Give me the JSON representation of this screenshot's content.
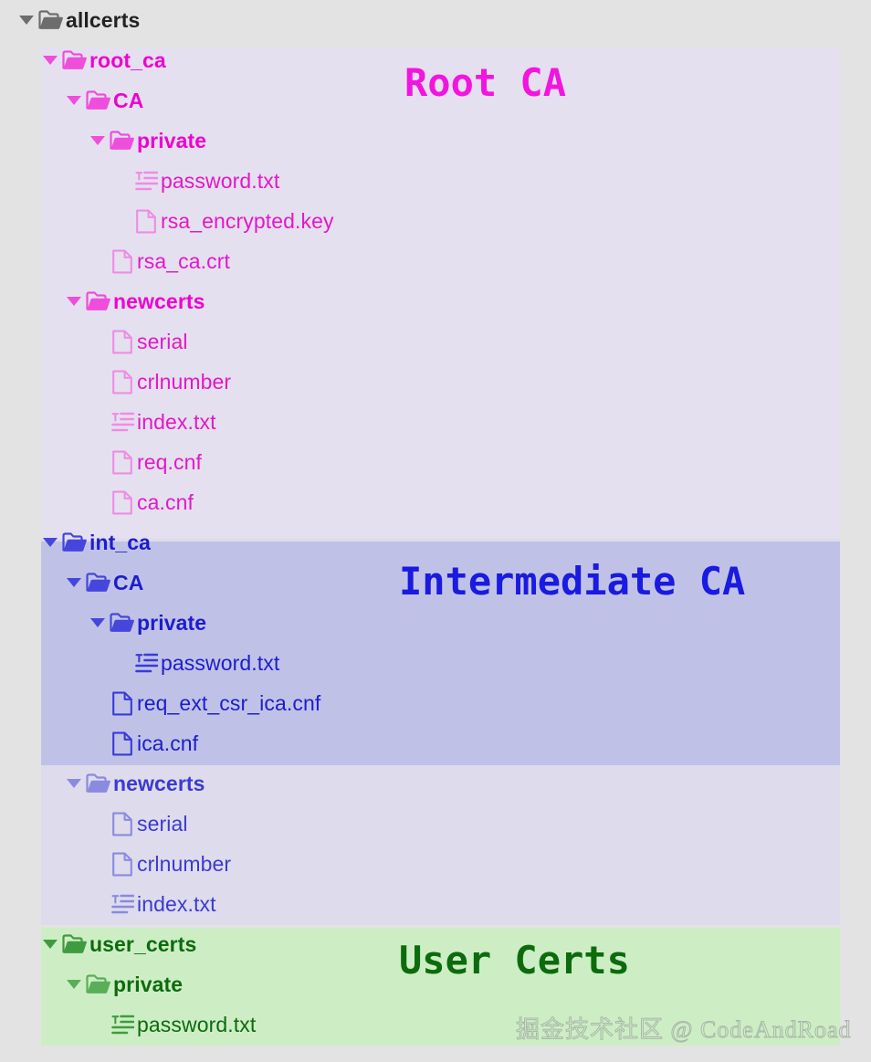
{
  "root_label": "allcerts",
  "groups": [
    {
      "id": "root_ca",
      "annotation": "Root CA",
      "accent": "#f215e0"
    },
    {
      "id": "int_ca",
      "annotation": "Intermediate CA",
      "accent": "#1a1ae0"
    },
    {
      "id": "user_certs",
      "annotation": "User Certs",
      "accent": "#0c6b0c"
    }
  ],
  "tree": [
    {
      "label": "allcerts",
      "kind": "folder",
      "icon": "folder-icon",
      "depth": 0,
      "expanded": true,
      "theme": "c-gray"
    },
    {
      "label": "root_ca",
      "kind": "folder",
      "icon": "folder-icon",
      "depth": 1,
      "expanded": true,
      "theme": "c-pinkd"
    },
    {
      "label": "CA",
      "kind": "folder",
      "icon": "folder-icon",
      "depth": 2,
      "expanded": true,
      "theme": "c-pinkd"
    },
    {
      "label": "private",
      "kind": "folder",
      "icon": "folder-icon",
      "depth": 3,
      "expanded": true,
      "theme": "c-pinkd"
    },
    {
      "label": "password.txt",
      "kind": "file",
      "icon": "text-file-icon",
      "depth": 4,
      "expanded": false,
      "theme": "c-pinkl"
    },
    {
      "label": "rsa_encrypted.key",
      "kind": "file",
      "icon": "file-icon",
      "depth": 4,
      "expanded": false,
      "theme": "c-pinkl"
    },
    {
      "label": "rsa_ca.crt",
      "kind": "file",
      "icon": "file-icon",
      "depth": 3,
      "expanded": false,
      "theme": "c-pinkl"
    },
    {
      "label": "newcerts",
      "kind": "folder",
      "icon": "folder-icon",
      "depth": 2,
      "expanded": true,
      "theme": "c-pinkd"
    },
    {
      "label": "serial",
      "kind": "file",
      "icon": "file-icon",
      "depth": 3,
      "expanded": false,
      "theme": "c-pinkl"
    },
    {
      "label": "crlnumber",
      "kind": "file",
      "icon": "file-icon",
      "depth": 3,
      "expanded": false,
      "theme": "c-pinkl"
    },
    {
      "label": "index.txt",
      "kind": "file",
      "icon": "text-file-icon",
      "depth": 3,
      "expanded": false,
      "theme": "c-pinkl"
    },
    {
      "label": "req.cnf",
      "kind": "file",
      "icon": "file-icon",
      "depth": 3,
      "expanded": false,
      "theme": "c-pinkl"
    },
    {
      "label": "ca.cnf",
      "kind": "file",
      "icon": "file-icon",
      "depth": 3,
      "expanded": false,
      "theme": "c-pinkl"
    },
    {
      "label": "int_ca",
      "kind": "folder",
      "icon": "folder-icon",
      "depth": 1,
      "expanded": true,
      "theme": "c-bluem"
    },
    {
      "label": "CA",
      "kind": "folder",
      "icon": "folder-icon",
      "depth": 2,
      "expanded": true,
      "theme": "c-bluem"
    },
    {
      "label": "private",
      "kind": "folder",
      "icon": "folder-icon",
      "depth": 3,
      "expanded": true,
      "theme": "c-bluem"
    },
    {
      "label": "password.txt",
      "kind": "file",
      "icon": "text-file-icon",
      "depth": 4,
      "expanded": false,
      "theme": "c-blued"
    },
    {
      "label": "req_ext_csr_ica.cnf",
      "kind": "file",
      "icon": "file-icon",
      "depth": 3,
      "expanded": false,
      "theme": "c-blued"
    },
    {
      "label": "ica.cnf",
      "kind": "file",
      "icon": "file-icon",
      "depth": 3,
      "expanded": false,
      "theme": "c-blued"
    },
    {
      "label": "newcerts",
      "kind": "folder",
      "icon": "folder-icon",
      "depth": 2,
      "expanded": true,
      "theme": "c-bluel"
    },
    {
      "label": "serial",
      "kind": "file",
      "icon": "file-icon",
      "depth": 3,
      "expanded": false,
      "theme": "c-bluel"
    },
    {
      "label": "crlnumber",
      "kind": "file",
      "icon": "file-icon",
      "depth": 3,
      "expanded": false,
      "theme": "c-bluel"
    },
    {
      "label": "index.txt",
      "kind": "file",
      "icon": "text-file-icon",
      "depth": 3,
      "expanded": false,
      "theme": "c-bluel"
    },
    {
      "label": "user_certs",
      "kind": "folder",
      "icon": "folder-icon",
      "depth": 1,
      "expanded": true,
      "theme": "c-greend"
    },
    {
      "label": "private",
      "kind": "folder",
      "icon": "folder-icon",
      "depth": 2,
      "expanded": true,
      "theme": "c-greenm"
    },
    {
      "label": "password.txt",
      "kind": "file",
      "icon": "text-file-icon",
      "depth": 3,
      "expanded": false,
      "theme": "c-greend"
    }
  ],
  "watermark": "掘金技术社区 @ CodeAndRoad"
}
